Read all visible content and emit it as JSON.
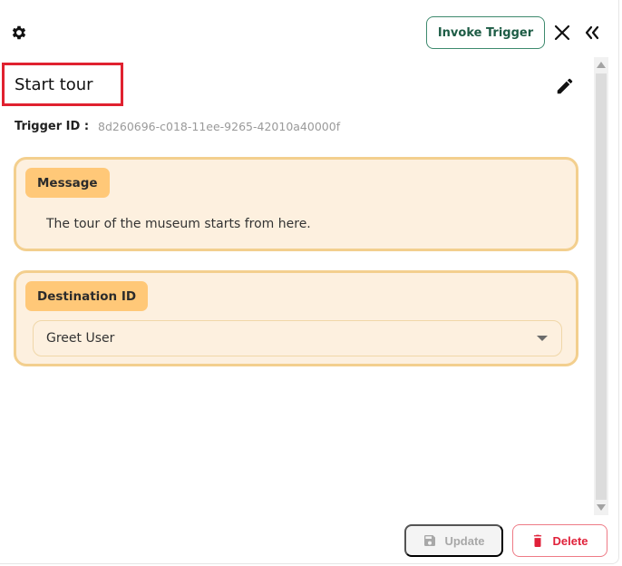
{
  "header": {
    "settings_icon": "gear-icon",
    "invoke_label": "Invoke Trigger",
    "close_icon": "close-icon",
    "collapse_icon": "double-chevron-left-icon"
  },
  "trigger": {
    "name": "Start tour",
    "id_label": "Trigger ID :",
    "id_value": "8d260696-c018-11ee-9265-42010a40000f"
  },
  "message_card": {
    "label": "Message",
    "text": "The tour of the museum starts from here."
  },
  "destination_card": {
    "label": "Destination ID",
    "selected": "Greet User"
  },
  "footer": {
    "update_label": "Update",
    "delete_label": "Delete"
  },
  "colors": {
    "accent_green": "#1d5c45",
    "card_bg": "#fdf0df",
    "card_border": "#f3cf8e",
    "chip_bg": "#ffc878",
    "highlight_red": "#e0212f",
    "delete_red": "#e0213a"
  }
}
